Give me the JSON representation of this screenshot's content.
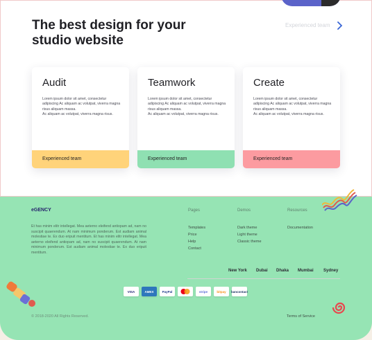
{
  "hero": {
    "headline": "The best design for your studio website",
    "explore_link": "Experienced team"
  },
  "cards": [
    {
      "title": "Audit",
      "body": "Lorem ipsum dolor sit amet, consectetur adipiscing Ac aliquam ac volutpat, viverra magna risus aliquam massa.\nAc aliquam ac volutpat, viverra magna risus.",
      "footer": "Experienced team",
      "accent": "#ffd37a"
    },
    {
      "title": "Teamwork",
      "body": "Lorem ipsum dolor sit amet, consectetur adipiscing Ac aliquam ac volutpat, viverra magna risus aliquam massa.\nAc aliquam ac volutpat, viverra magna risus.",
      "footer": "Experienced team",
      "accent": "#8fe0b2"
    },
    {
      "title": "Create",
      "body": "Lorem ipsum dolor sit amet, consectetur adipiscing Ac aliquam ac volutpat, viverra magna risus aliquam massa.\nAc aliquam ac volutpat, viverra magna risus.",
      "footer": "Experienced team",
      "accent": "#fc9ba0"
    }
  ],
  "footer": {
    "brand": "eGENCY",
    "about": "Et has minim elitr intellegat. Mea aeterno eleifend antiopam ad, nam no suscipit quaerendum. At nam minimum ponderum. Est audiam animal molestiae te. Ex duo eripuit mentitum. Et has minim elitr intellegat. Mea aeterno eleifend antiopam ad, nam no suscipit quaerendum. At nam minimum ponderum. Est audiam animal molestiae te. Ex duo eripuit mentitum.",
    "columns": [
      {
        "heading": "Pages",
        "links": [
          "Templates",
          "Price",
          "Help",
          "Contact"
        ]
      },
      {
        "heading": "Demos",
        "links": [
          "Dark theme",
          "Light theme",
          "Classic theme"
        ]
      },
      {
        "heading": "Resources",
        "links": [
          "Documentation"
        ]
      }
    ],
    "cities": [
      "New York",
      "Dubai",
      "Dhaka",
      "Mumbai",
      "Sydney"
    ],
    "payments": [
      "VISA",
      "AMEX",
      "PayPal",
      "mastercard",
      "stripe",
      "bitpay",
      "bancontact"
    ],
    "copyright": "© 2018-2020 All Rights Reserved.",
    "terms": "Terms of Service"
  },
  "colors": {
    "footer_bg": "#96e4b4",
    "brand": "#25236b"
  }
}
